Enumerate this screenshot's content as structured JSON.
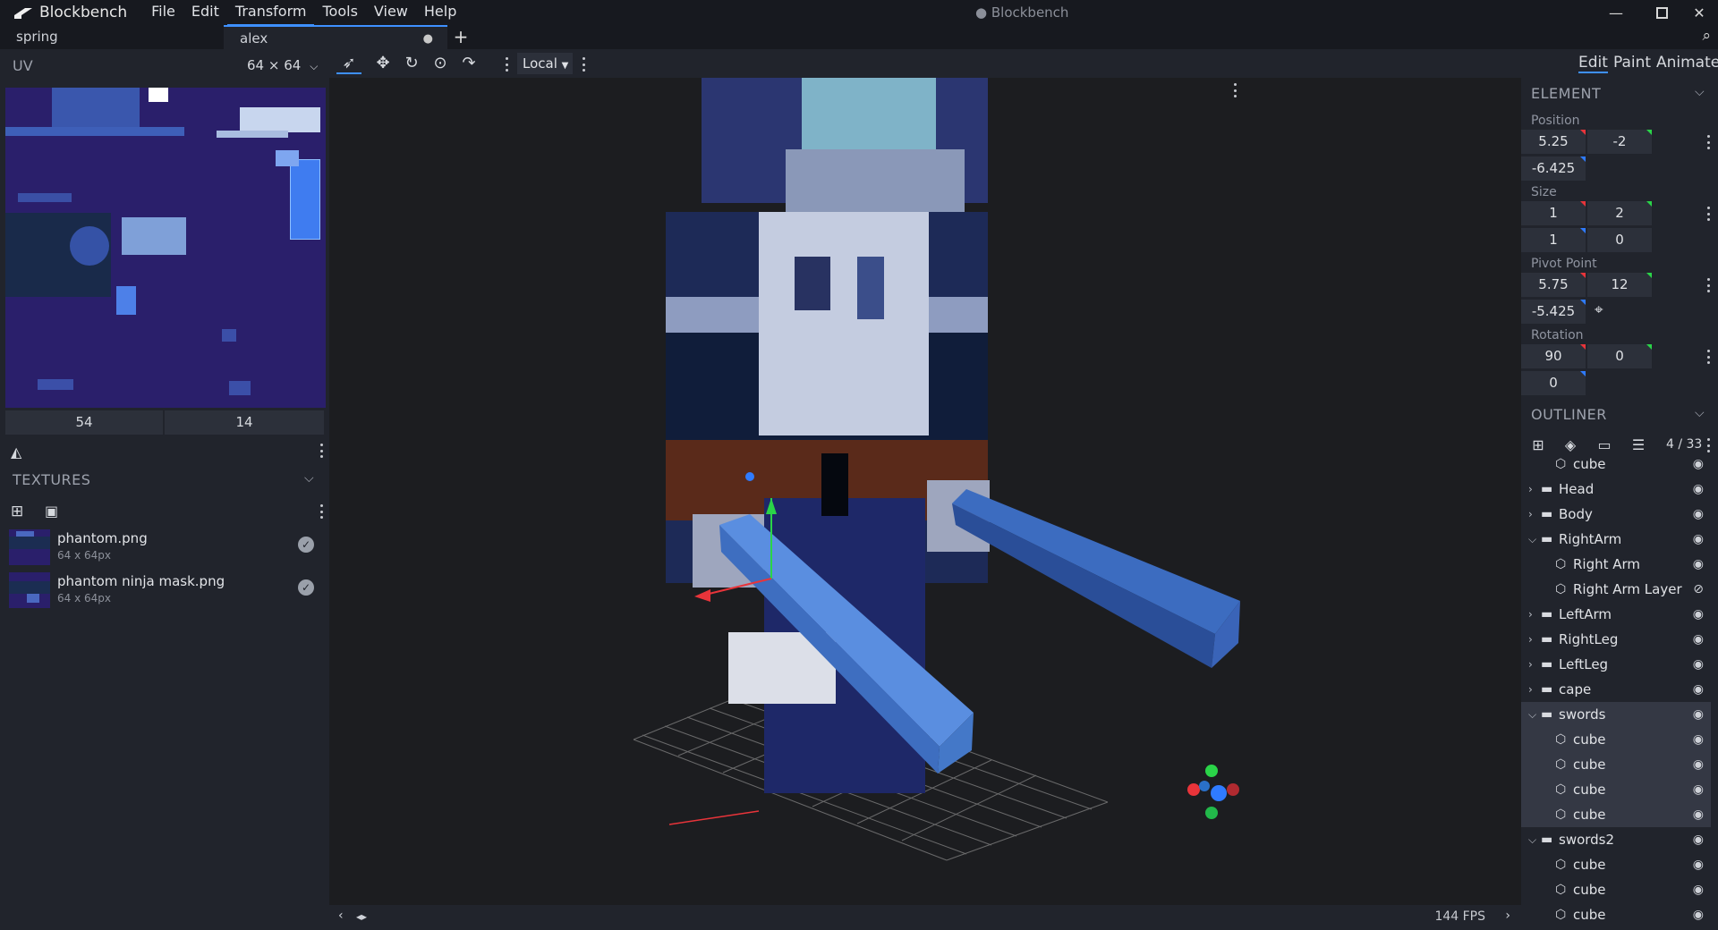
{
  "app": {
    "name": "Blockbench",
    "window_title": "Blockbench",
    "menu": [
      "File",
      "Edit",
      "Transform",
      "Tools",
      "View",
      "Help"
    ]
  },
  "tabs": [
    {
      "label": "spring"
    },
    {
      "label": "alex"
    }
  ],
  "uv": {
    "title": "UV",
    "size_select": "64 × 64",
    "coords": [
      "54",
      "14"
    ]
  },
  "textures": {
    "title": "TEXTURES",
    "items": [
      {
        "name": "phantom.png",
        "size": "64 x 64px"
      },
      {
        "name": "phantom ninja mask.png",
        "size": "64 x 64px"
      }
    ]
  },
  "toolbar": {
    "space": "Local"
  },
  "modes": [
    "Edit",
    "Paint",
    "Animate"
  ],
  "element": {
    "title": "ELEMENT",
    "position_label": "Position",
    "position": [
      "5.25",
      "-2",
      "-6.425"
    ],
    "size_label": "Size",
    "size": [
      "1",
      "2",
      "1",
      "0"
    ],
    "pivot_label": "Pivot Point",
    "pivot": [
      "5.75",
      "12",
      "-5.425"
    ],
    "rotation_label": "Rotation",
    "rotation": [
      "90",
      "0",
      "0"
    ]
  },
  "outliner": {
    "title": "OUTLINER",
    "count": "4 / 33",
    "rows": [
      {
        "label": "cube",
        "type": "cube",
        "depth": 1,
        "hl": false
      },
      {
        "label": "Head",
        "type": "group",
        "depth": 0,
        "open": false,
        "hl": false
      },
      {
        "label": "Body",
        "type": "group",
        "depth": 0,
        "open": false,
        "hl": false
      },
      {
        "label": "RightArm",
        "type": "group",
        "depth": 0,
        "open": true,
        "hl": false
      },
      {
        "label": "Right Arm",
        "type": "cube",
        "depth": 1,
        "hl": false
      },
      {
        "label": "Right Arm Layer",
        "type": "cube",
        "depth": 1,
        "hl": false,
        "hidden": true
      },
      {
        "label": "LeftArm",
        "type": "group",
        "depth": 0,
        "open": false,
        "hl": false
      },
      {
        "label": "RightLeg",
        "type": "group",
        "depth": 0,
        "open": false,
        "hl": false
      },
      {
        "label": "LeftLeg",
        "type": "group",
        "depth": 0,
        "open": false,
        "hl": false
      },
      {
        "label": "cape",
        "type": "group",
        "depth": 0,
        "open": false,
        "hl": false
      },
      {
        "label": "swords",
        "type": "group",
        "depth": 0,
        "open": true,
        "hl": true
      },
      {
        "label": "cube",
        "type": "cube",
        "depth": 1,
        "hl": true
      },
      {
        "label": "cube",
        "type": "cube",
        "depth": 1,
        "hl": true
      },
      {
        "label": "cube",
        "type": "cube",
        "depth": 1,
        "hl": true
      },
      {
        "label": "cube",
        "type": "cube",
        "depth": 1,
        "hl": true
      },
      {
        "label": "swords2",
        "type": "group",
        "depth": 0,
        "open": true,
        "hl": false
      },
      {
        "label": "cube",
        "type": "cube",
        "depth": 1,
        "hl": false
      },
      {
        "label": "cube",
        "type": "cube",
        "depth": 1,
        "hl": false
      },
      {
        "label": "cube",
        "type": "cube",
        "depth": 1,
        "hl": false
      }
    ]
  },
  "viewport": {
    "fps": "144 FPS"
  },
  "colors": {
    "accent": "#3e90ff",
    "axis_x": "#e8343a",
    "axis_y": "#2ad448",
    "axis_z": "#2f7bff"
  }
}
